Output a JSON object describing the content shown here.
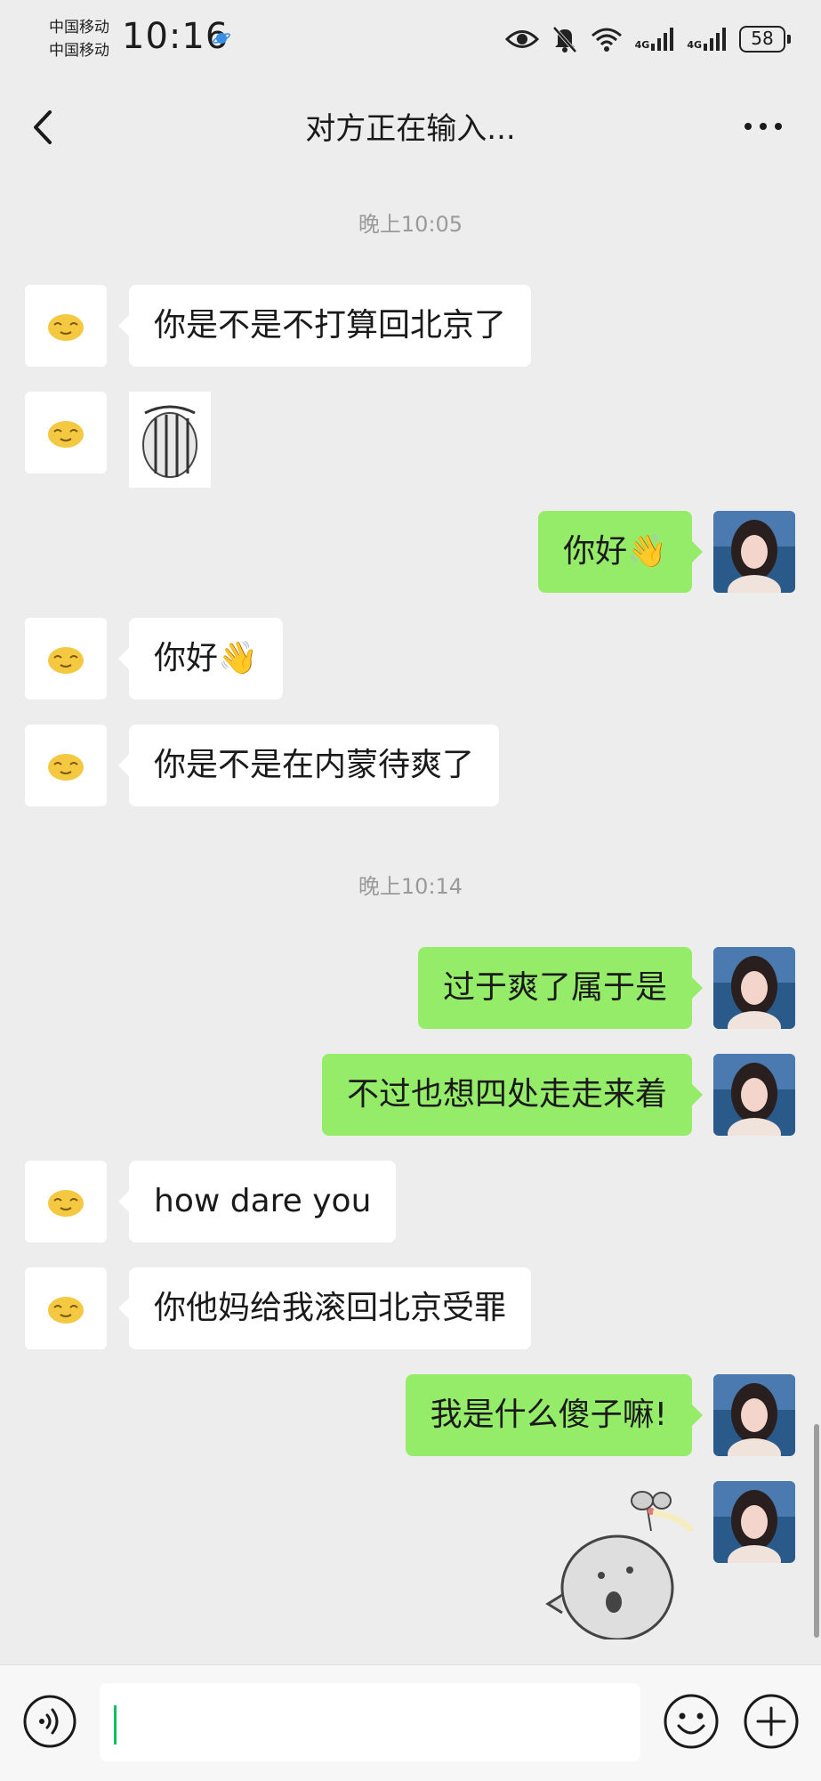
{
  "status_bar": {
    "carrier_1": "中国移动",
    "carrier_2": "中国移动",
    "time": "10:16",
    "net_1": "4G",
    "net_2": "4G",
    "battery": "58"
  },
  "header": {
    "title": "对方正在输入..."
  },
  "chat": {
    "timestamps": [
      "晚上10:05",
      "晚上10:14"
    ],
    "messages": [
      {
        "side": "in",
        "text": "你是不是不打算回北京了"
      },
      {
        "side": "in",
        "type": "sticker"
      },
      {
        "side": "out",
        "text": "你好👋"
      },
      {
        "side": "in",
        "text": "你好👋"
      },
      {
        "side": "in",
        "text": "你是不是在内蒙待爽了"
      },
      {
        "side": "out",
        "text": "过于爽了属于是"
      },
      {
        "side": "out",
        "text": "不过也想四处走走来着"
      },
      {
        "side": "in",
        "text": "how dare you"
      },
      {
        "side": "in",
        "text": "你他妈给我滚回北京受罪"
      },
      {
        "side": "out",
        "text": "我是什么傻子嘛!"
      },
      {
        "side": "out",
        "type": "sticker"
      }
    ]
  },
  "colors": {
    "outgoing_bubble": "#95ec69",
    "incoming_bubble": "#ffffff",
    "background": "#ededed",
    "caret": "#07c160"
  },
  "icons": {
    "back": "chevron-left-icon",
    "more": "more-dots-icon",
    "voice": "voice-icon",
    "emoji": "emoji-icon",
    "plus": "plus-icon"
  }
}
